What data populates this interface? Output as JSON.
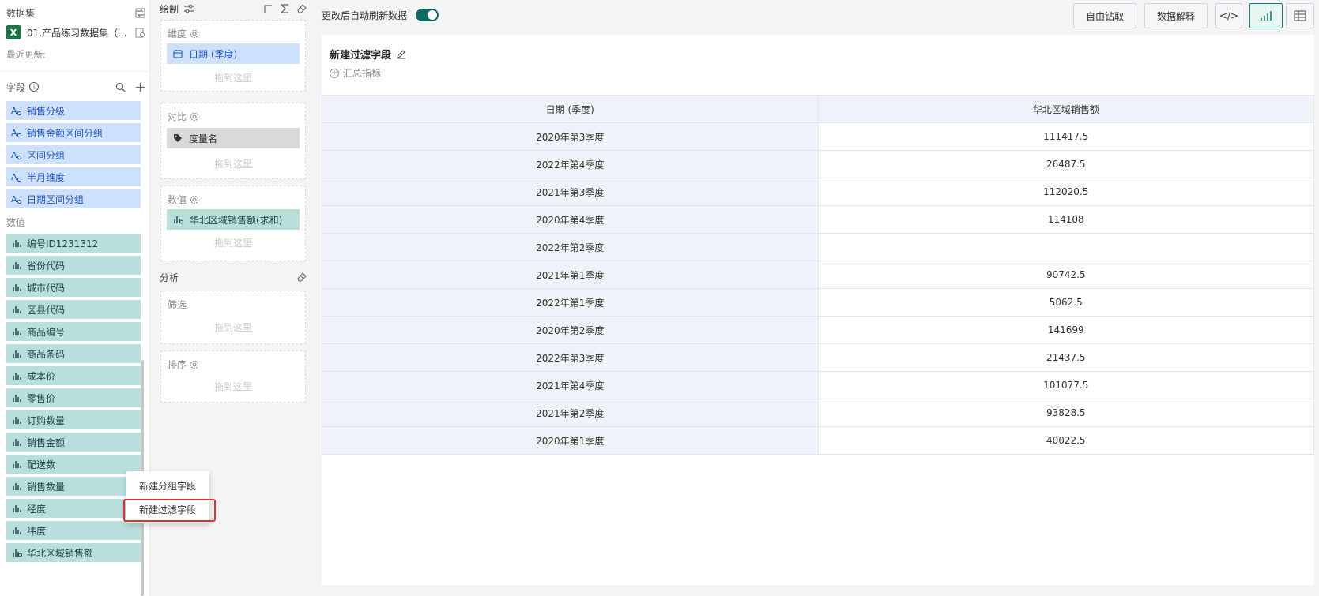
{
  "dataset": {
    "title": "数据集",
    "name": "01.产品练习数据集（...",
    "excel_badge": "X",
    "updated_label": "最近更新:"
  },
  "fields": {
    "title": "字段",
    "dimension_items": [
      "销售分级",
      "销售金额区间分组",
      "区间分组",
      "半月维度",
      "日期区间分组"
    ],
    "numeric_group_label": "数值",
    "numeric_items": [
      "编号ID1231312",
      "省份代码",
      "城市代码",
      "区县代码",
      "商品编号",
      "商品条码",
      "成本价",
      "零售价",
      "订购数量",
      "销售金额",
      "配送数",
      "销售数量",
      "经度",
      "纬度",
      "华北区域销售额"
    ]
  },
  "draw": {
    "title": "绘制",
    "sections": [
      {
        "label": "维度",
        "chip": "日期 (季度)",
        "placeholder": "拖到这里"
      },
      {
        "label": "对比",
        "chip": "度量名",
        "placeholder": "拖到这里"
      },
      {
        "label": "数值",
        "chip": "华北区域销售额(求和)",
        "placeholder": "拖到这里"
      }
    ],
    "analysis_title": "分析",
    "filter": {
      "label": "筛选",
      "placeholder": "拖到这里"
    },
    "sort": {
      "label": "排序",
      "placeholder": "拖到这里"
    }
  },
  "toolbar": {
    "auto_refresh_label": "更改后自动刷新数据",
    "auto_refresh_on": true,
    "drill_label": "自由钻取",
    "explain_label": "数据解释",
    "code_label": "</>"
  },
  "card": {
    "title": "新建过滤字段",
    "summary_label": "汇总指标"
  },
  "table": {
    "headers": [
      "日期 (季度)",
      "华北区域销售额"
    ],
    "rows": [
      [
        "2020年第3季度",
        "111417.5"
      ],
      [
        "2022年第4季度",
        "26487.5"
      ],
      [
        "2021年第3季度",
        "112020.5"
      ],
      [
        "2020年第4季度",
        "114108"
      ],
      [
        "2022年第2季度",
        ""
      ],
      [
        "2021年第1季度",
        "90742.5"
      ],
      [
        "2022年第1季度",
        "5062.5"
      ],
      [
        "2020年第2季度",
        "141699"
      ],
      [
        "2022年第3季度",
        "21437.5"
      ],
      [
        "2021年第4季度",
        "101077.5"
      ],
      [
        "2021年第2季度",
        "93828.5"
      ],
      [
        "2020年第1季度",
        "40022.5"
      ]
    ]
  },
  "context_menu": {
    "items": [
      "新建分组字段",
      "新建过滤字段"
    ],
    "highlighted_index": 1
  },
  "colors": {
    "accent": "#1b7e72",
    "dimension_bg": "#cfe0fb",
    "dimension_text": "#1f56c4",
    "numeric_bg": "#b9dfdb",
    "highlight_border": "#e03131"
  }
}
